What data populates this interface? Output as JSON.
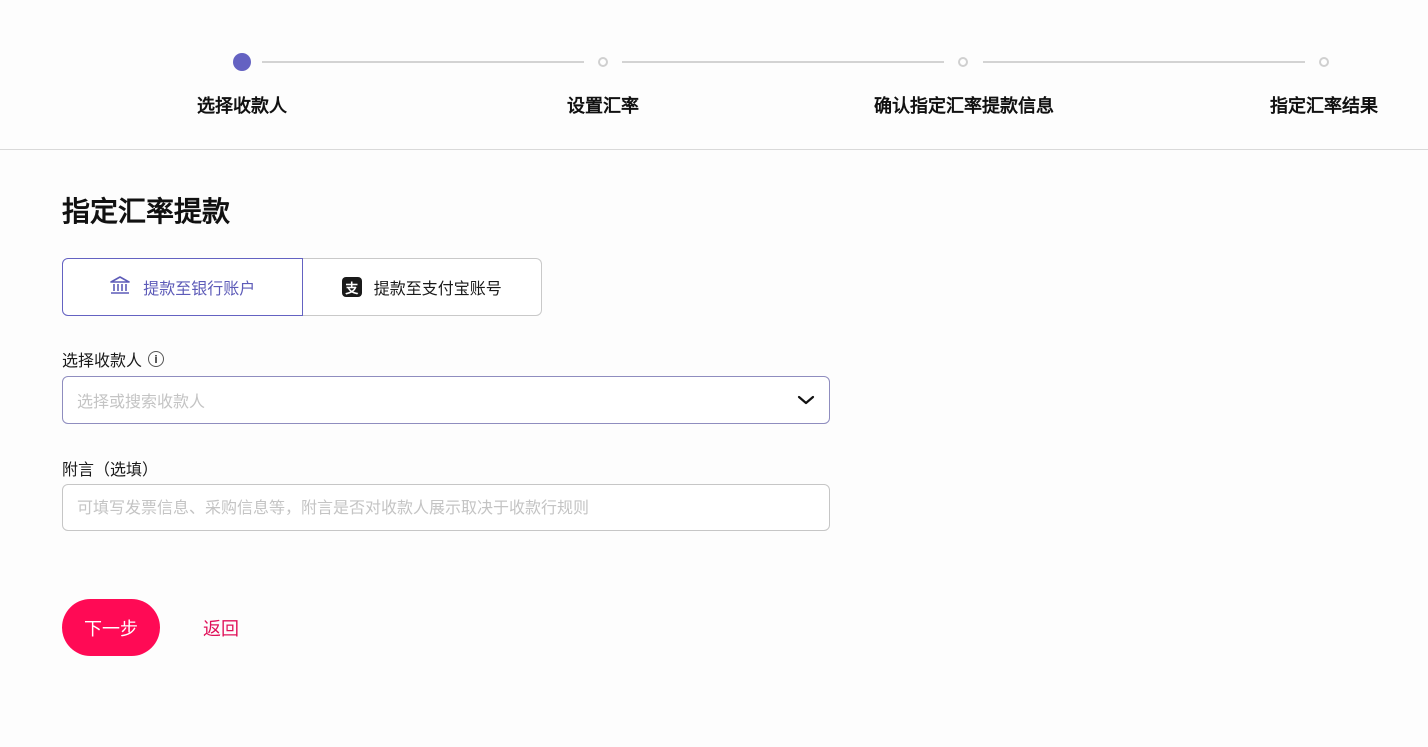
{
  "stepper": {
    "steps": [
      {
        "label": "选择收款人",
        "state": "active"
      },
      {
        "label": "设置汇率",
        "state": "pending"
      },
      {
        "label": "确认指定汇率提款信息",
        "state": "pending"
      },
      {
        "label": "指定汇率结果",
        "state": "pending"
      }
    ]
  },
  "page": {
    "title": "指定汇率提款"
  },
  "withdraw_methods": {
    "bank": {
      "label": "提款至银行账户",
      "icon": "bank-icon",
      "selected": true
    },
    "alipay": {
      "label": "提款至支付宝账号",
      "icon": "alipay-icon",
      "glyph": "支",
      "selected": false
    }
  },
  "payee": {
    "label": "选择收款人",
    "placeholder": "选择或搜索收款人"
  },
  "note": {
    "label": "附言（选填）",
    "placeholder": "可填写发票信息、采购信息等，附言是否对收款人展示取决于收款行规则",
    "value": ""
  },
  "actions": {
    "next_label": "下一步",
    "back_label": "返回"
  },
  "colors": {
    "accent": "#6462c2",
    "primary_button": "#ff0a55",
    "link": "#e0125a"
  }
}
